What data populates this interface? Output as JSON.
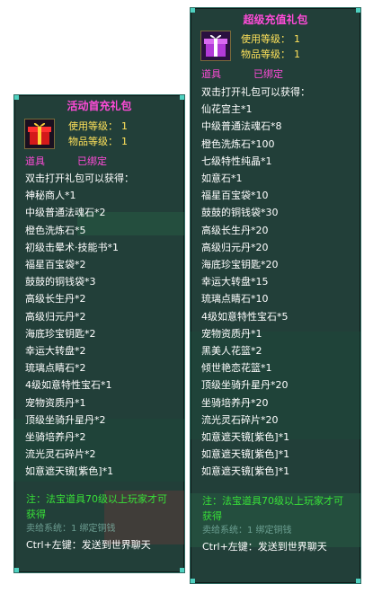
{
  "left": {
    "title": "活动首充礼包",
    "use_level_label": "使用等级：",
    "use_level": "1",
    "item_level_label": "物品等级：",
    "item_level": "1",
    "type": "道具",
    "bound": "已绑定",
    "desc": "双击打开礼包可以获得：",
    "items": [
      "神秘商人*1",
      "中级普通法魂石*2",
      "橙色洗炼石*5",
      "初级击晕术·技能书*1",
      "福星百宝袋*2",
      "鼓鼓的铜钱袋*3",
      "高级长生丹*2",
      "高级归元丹*2",
      "海底珍宝钥匙*2",
      "幸运大转盘*2",
      "琉璃点睛石*2",
      "4级如意特性宝石*1",
      "宠物资质丹*1",
      "顶级坐骑升星丹*2",
      "坐骑培养丹*2",
      "流光灵石碎片*2",
      "如意遮天镜[紫色]*1"
    ],
    "note_line1": "注：法宝道具70级以上玩家才可",
    "note_line2": "获得",
    "sale": "卖给系统：1 绑定铜钱",
    "ctrl": "Ctrl+左键：发送到世界聊天"
  },
  "right": {
    "title": "超级充值礼包",
    "use_level_label": "使用等级：",
    "use_level": "1",
    "item_level_label": "物品等级：",
    "item_level": "1",
    "type": "道具",
    "bound": "已绑定",
    "desc": "双击打开礼包可以获得：",
    "items": [
      "仙花宫主*1",
      "中级普通法魂石*8",
      "橙色洗炼石*100",
      "七级特性纯晶*1",
      "如意石*1",
      "福星百宝袋*10",
      "鼓鼓的铜钱袋*30",
      "高级长生丹*20",
      "高级归元丹*20",
      "海底珍宝钥匙*20",
      "幸运大转盘*15",
      "琉璃点睛石*10",
      "4级如意特性宝石*5",
      "宠物资质丹*1",
      "黑美人花篮*2",
      "倾世艳恋花篮*1",
      "顶级坐骑升星丹*20",
      "坐骑培养丹*20",
      "流光灵石碎片*20",
      "如意遮天镜[紫色]*1",
      "如意遮天镜[紫色]*1",
      "如意遮天镜[紫色]*1"
    ],
    "note_line1": "注：法宝道具70级以上玩家才可",
    "note_line2": "获得",
    "sale": "卖给系统：1 绑定铜钱",
    "ctrl": "Ctrl+左键：发送到世界聊天"
  },
  "colors": {
    "panel_bg": "#0a2a24",
    "title": "#ff4bd8",
    "level": "#ffe25a",
    "note": "#38e038",
    "border": "#2d6b62"
  },
  "icons": {
    "left_gift": "red-gift-box-icon",
    "right_gift": "purple-gift-box-icon"
  }
}
